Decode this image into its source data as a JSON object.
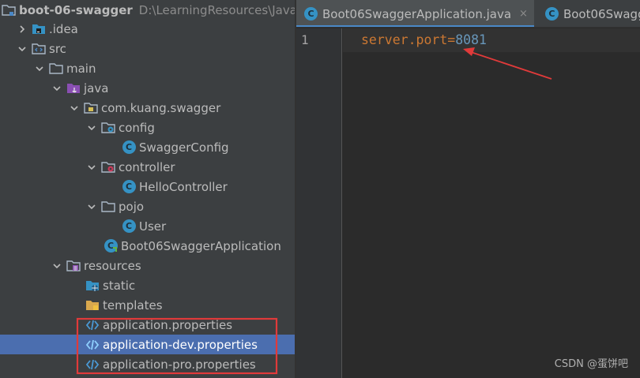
{
  "project": {
    "name": "boot-06-swagger",
    "path": "D:\\LearningResources\\Java",
    "items": [
      {
        "label": "boot-06-swagger"
      },
      {
        "label": ".idea"
      },
      {
        "label": "src"
      },
      {
        "label": "main"
      },
      {
        "label": "java"
      },
      {
        "label": "com.kuang.swagger"
      },
      {
        "label": "config"
      },
      {
        "label": "SwaggerConfig"
      },
      {
        "label": "controller"
      },
      {
        "label": "HelloController"
      },
      {
        "label": "pojo"
      },
      {
        "label": "User"
      },
      {
        "label": "Boot06SwaggerApplication"
      },
      {
        "label": "resources"
      },
      {
        "label": "static"
      },
      {
        "label": "templates"
      },
      {
        "label": "application.properties"
      },
      {
        "label": "application-dev.properties"
      },
      {
        "label": "application-pro.properties"
      }
    ]
  },
  "editor": {
    "tabs": [
      {
        "label": "Boot06SwaggerApplication.java",
        "icon_letter": "C",
        "close": "×"
      },
      {
        "label": "Boot06Swagge",
        "icon_letter": "C"
      }
    ],
    "line_number": "1",
    "code": {
      "key": "server.port",
      "eq": "=",
      "value": "8081"
    }
  },
  "icons": {
    "class": "class-icon",
    "folder": "folder-icon",
    "properties": "properties-file-icon",
    "expand": "chevron-down-icon",
    "collapse": "chevron-right-icon"
  },
  "colors": {
    "selection": "#4b6eaf",
    "highlight_box": "#e03a3a",
    "arrow": "#e03a3a",
    "class_icon": "#3592c4",
    "property_key": "#cc7832",
    "property_value": "#6897bb"
  },
  "watermark": "CSDN @蛋饼吧"
}
